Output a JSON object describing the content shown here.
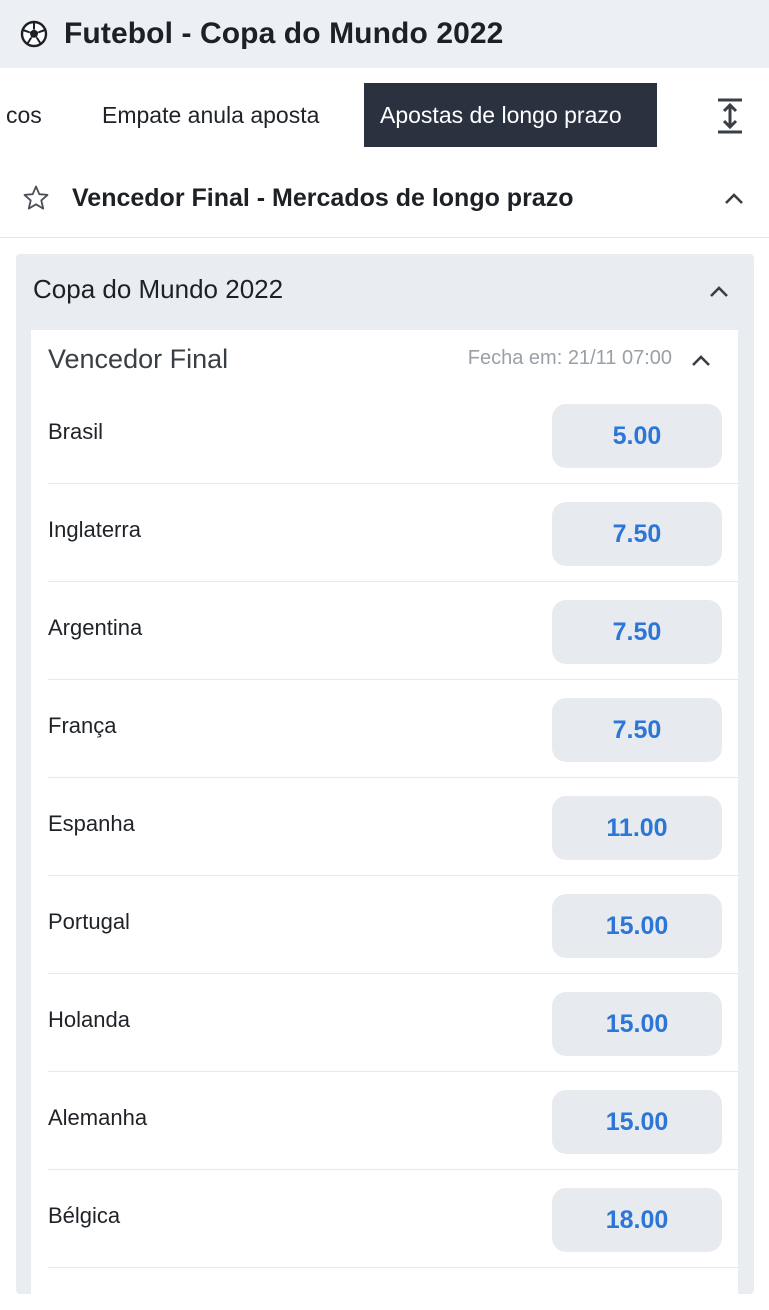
{
  "header": {
    "title": "Futebol - Copa do Mundo 2022"
  },
  "tabs": [
    {
      "label": "cos"
    },
    {
      "label": "Empate anula aposta"
    },
    {
      "label": "Apostas de longo prazo"
    }
  ],
  "section": {
    "title": "Vencedor Final - Mercados de longo prazo"
  },
  "competition": {
    "title": "Copa do Mundo 2022",
    "market": {
      "title": "Vencedor Final",
      "closes": "Fecha em: 21/11 07:00",
      "selections": [
        {
          "name": "Brasil",
          "odd": "5.00"
        },
        {
          "name": "Inglaterra",
          "odd": "7.50"
        },
        {
          "name": "Argentina",
          "odd": "7.50"
        },
        {
          "name": "França",
          "odd": "7.50"
        },
        {
          "name": "Espanha",
          "odd": "11.00"
        },
        {
          "name": "Portugal",
          "odd": "15.00"
        },
        {
          "name": "Holanda",
          "odd": "15.00"
        },
        {
          "name": "Alemanha",
          "odd": "15.00"
        },
        {
          "name": "Bélgica",
          "odd": "18.00"
        }
      ]
    }
  },
  "colors": {
    "odd_text": "#2b76d6",
    "active_tab_bg": "#2a3240",
    "header_bg": "#eceff3"
  }
}
